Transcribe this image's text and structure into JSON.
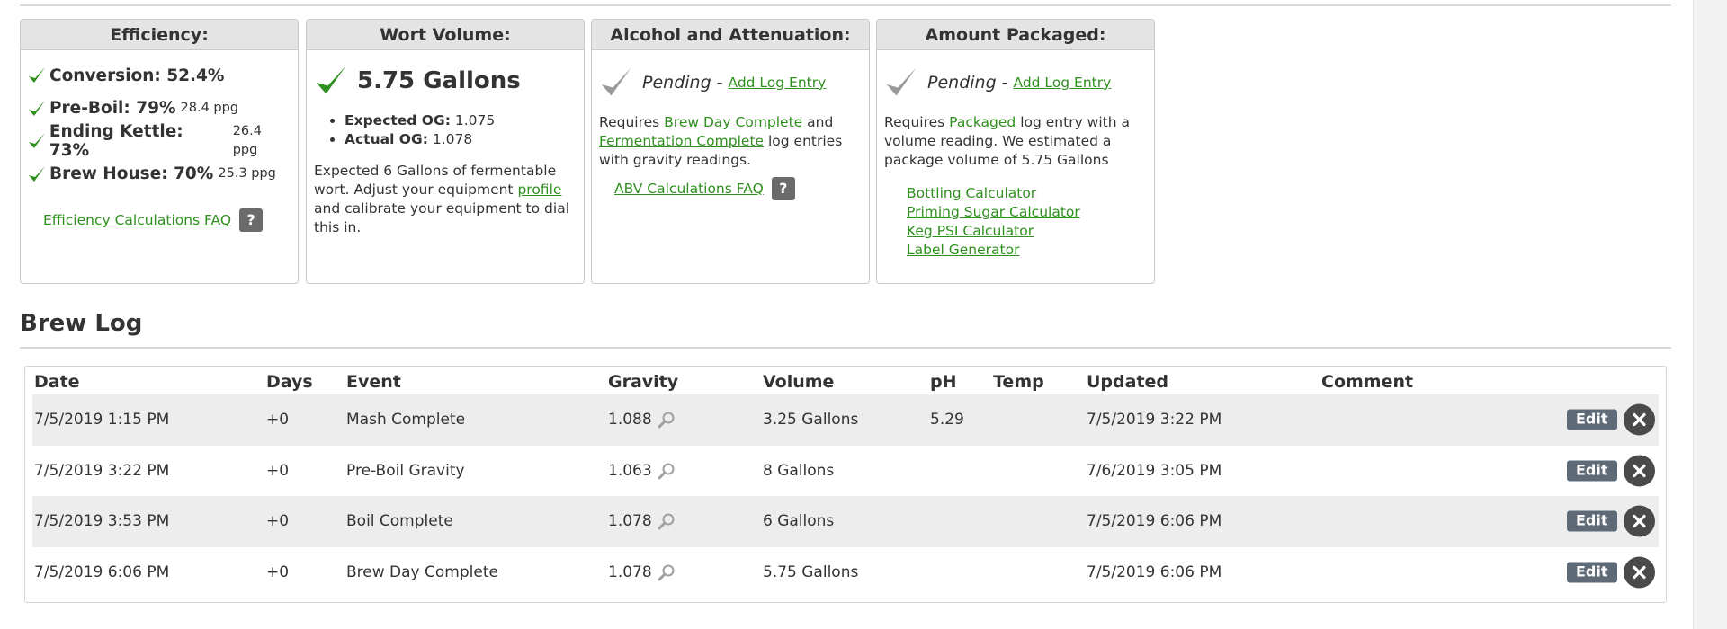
{
  "efficiency": {
    "title": "Efficiency:",
    "rows": [
      {
        "label": "Conversion: 52.4%",
        "detail": ""
      },
      {
        "label": "Pre-Boil: 79%",
        "detail": "28.4 ppg"
      },
      {
        "label": "Ending Kettle: 73%",
        "detail": "26.4 ppg"
      },
      {
        "label": "Brew House: 70%",
        "detail": "25.3 ppg"
      }
    ],
    "faq_link": "Efficiency Calculations FAQ",
    "faq_help": "?"
  },
  "wort": {
    "title": "Wort Volume:",
    "volume": "5.75 Gallons",
    "expected_og_label": "Expected OG:",
    "expected_og": "1.075",
    "actual_og_label": "Actual OG:",
    "actual_og": "1.078",
    "note_1": "Expected 6 Gallons of fermentable wort. Adjust your equipment",
    "note_link": "profile",
    "note_2": "and calibrate your equipment to dial this in."
  },
  "abv": {
    "title": "Alcohol and Attenuation:",
    "status": "Pending",
    "dash": "-",
    "add_link": "Add Log Entry",
    "req_1": "Requires",
    "req_link_1": "Brew Day Complete",
    "req_2": "and",
    "req_link_2": "Fermentation Complete",
    "req_3": "log entries with gravity readings.",
    "faq_link": "ABV Calculations FAQ",
    "faq_help": "?"
  },
  "packaged": {
    "title": "Amount Packaged:",
    "status": "Pending",
    "dash": "-",
    "add_link": "Add Log Entry",
    "req_1": "Requires",
    "req_link": "Packaged",
    "req_2": "log entry with a volume reading. We estimated a package volume of 5.75 Gallons",
    "calculators": [
      "Bottling Calculator",
      "Priming Sugar Calculator",
      "Keg PSI Calculator",
      "Label Generator"
    ]
  },
  "brew_log": {
    "title": "Brew Log",
    "columns": {
      "date": "Date",
      "days": "Days",
      "event": "Event",
      "gravity": "Gravity",
      "volume": "Volume",
      "ph": "pH",
      "temp": "Temp",
      "updated": "Updated",
      "comment": "Comment"
    },
    "edit_label": "Edit",
    "rows": [
      {
        "date": "7/5/2019 1:15 PM",
        "days": "+0",
        "event": "Mash Complete",
        "gravity": "1.088",
        "volume": "3.25 Gallons",
        "ph": "5.29",
        "temp": "",
        "updated": "7/5/2019 3:22 PM",
        "comment": ""
      },
      {
        "date": "7/5/2019 3:22 PM",
        "days": "+0",
        "event": "Pre-Boil Gravity",
        "gravity": "1.063",
        "volume": "8 Gallons",
        "ph": "",
        "temp": "",
        "updated": "7/6/2019 3:05 PM",
        "comment": ""
      },
      {
        "date": "7/5/2019 3:53 PM",
        "days": "+0",
        "event": "Boil Complete",
        "gravity": "1.078",
        "volume": "6 Gallons",
        "ph": "",
        "temp": "",
        "updated": "7/5/2019 6:06 PM",
        "comment": ""
      },
      {
        "date": "7/5/2019 6:06 PM",
        "days": "+0",
        "event": "Brew Day Complete",
        "gravity": "1.078",
        "volume": "5.75 Gallons",
        "ph": "",
        "temp": "",
        "updated": "7/5/2019 6:06 PM",
        "comment": ""
      }
    ]
  },
  "colors": {
    "link": "#2f8f1f",
    "check_done": "#2f8f1f",
    "check_pending": "#9a9a9a",
    "edit_button": "#5e6a78",
    "delete_button": "#4a4a4a",
    "row_alt": "#ededed"
  },
  "icons": {
    "check": "checkmark-icon",
    "pending": "pending-check-icon",
    "magnifier": "magnifier-icon",
    "delete": "delete-icon"
  }
}
